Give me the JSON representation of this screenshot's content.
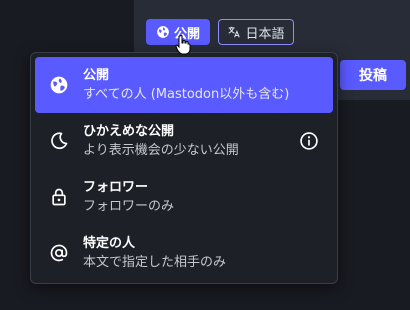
{
  "compose": {
    "privacy_label": "公開",
    "language_label": "日本語",
    "post_label": "投稿"
  },
  "visibility_menu": {
    "options": [
      {
        "title": "公開",
        "description": "すべての人 (Mastodon以外も含む)",
        "icon": "globe-icon",
        "selected": true
      },
      {
        "title": "ひかえめな公開",
        "description": "より表示機会の少ない公開",
        "icon": "moon-icon",
        "info_icon": "info-icon"
      },
      {
        "title": "フォロワー",
        "description": "フォロワーのみ",
        "icon": "lock-icon"
      },
      {
        "title": "特定の人",
        "description": "本文で指定した相手のみ",
        "icon": "at-icon"
      }
    ]
  },
  "colors": {
    "accent": "#595aff",
    "background": "#191b22",
    "panel": "#282c37",
    "menu_background": "#1e2028"
  }
}
